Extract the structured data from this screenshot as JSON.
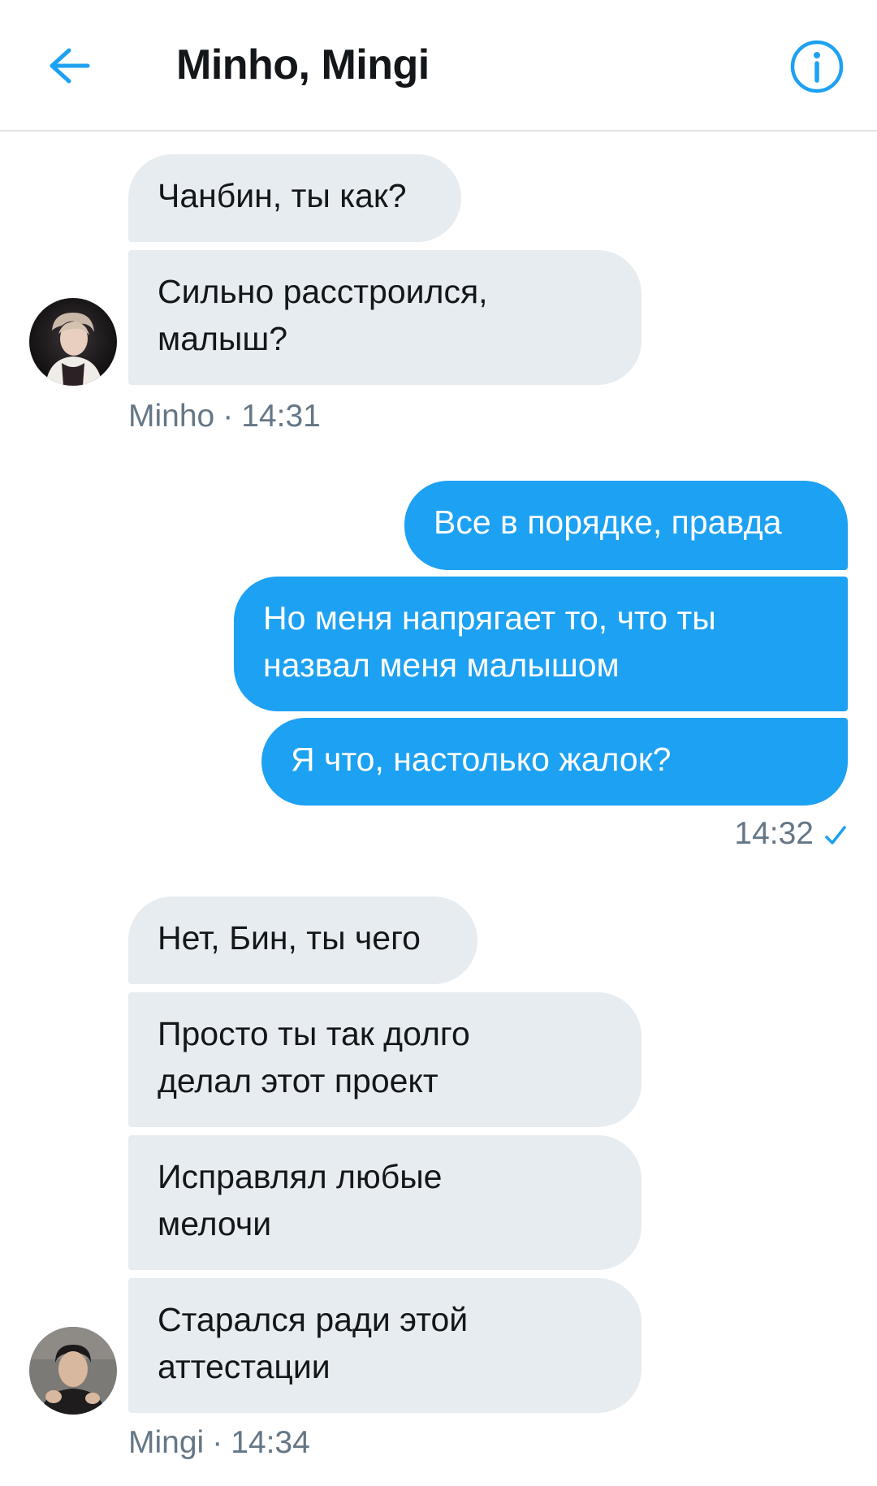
{
  "header": {
    "title": "Minho, Mingi",
    "back_icon": "arrow-left-icon",
    "info_icon": "info-icon",
    "accent_color": "#1da1f2"
  },
  "conversation": {
    "group1": {
      "sender": "Minho",
      "time": "14:31",
      "separator": "·",
      "messages": [
        "Чанбин, ты как?",
        "Сильно расстроился,",
        "малыш?"
      ]
    },
    "group2": {
      "time": "14:32",
      "status_icon": "checkmark-icon",
      "messages": [
        "Все в порядке, правда",
        "Но меня напрягает то, что ты",
        "назвал меня малышом",
        "Я что, настолько жалок?"
      ]
    },
    "group3": {
      "sender": "Mingi",
      "time": "14:34",
      "separator": "·",
      "messages": [
        "Нет, Бин, ты чего",
        "Просто ты так долго",
        "делал этот проект",
        "Исправлял любые",
        "мелочи",
        "Старался ради этой",
        "аттестации"
      ]
    }
  },
  "colors": {
    "incoming_bubble": "#e6ecf0",
    "outgoing_bubble": "#1da1f2",
    "meta_text": "#657786"
  }
}
